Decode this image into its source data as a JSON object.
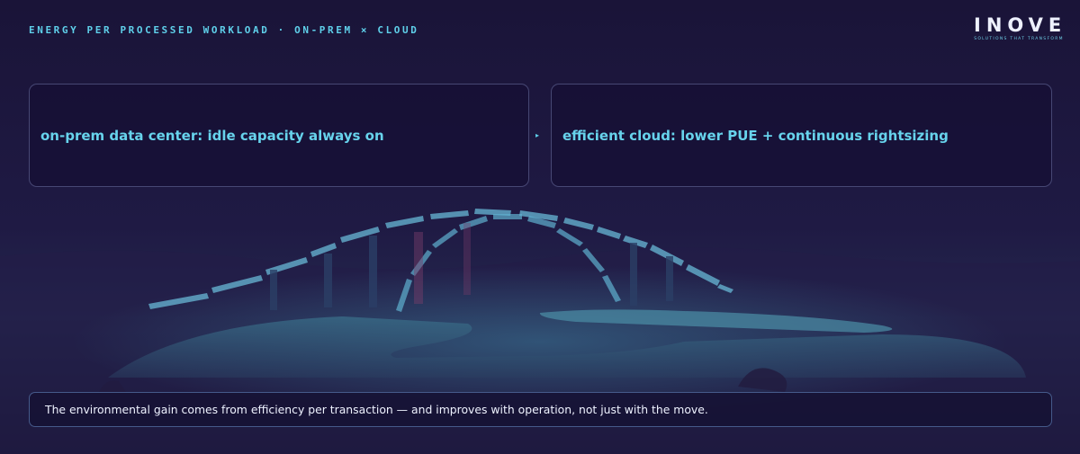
{
  "header": {
    "eyebrow": "ENERGY PER PROCESSED WORKLOAD · ON-PREM × CLOUD"
  },
  "logo": {
    "wordmark": "INOVE",
    "tagline": "SOLUTIONS THAT TRANSFORM"
  },
  "comparison": {
    "from_label": "on-prem data center: idle capacity always on",
    "arrow": "▸",
    "to_label": "efficient cloud: lower PUE + continuous rightsizing"
  },
  "footer": {
    "note": "The environmental gain comes from efficiency per transaction — and improves with operation, not just with the move."
  },
  "colors": {
    "background": "#1a1336",
    "accent": "#5fd0ea",
    "card_border": "#9aa0d7",
    "text_light": "#eef2ff"
  },
  "background_image": "night arch bridge with cyan lights over water"
}
